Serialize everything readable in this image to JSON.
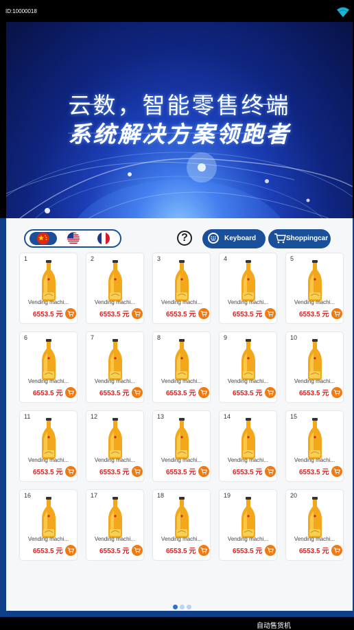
{
  "status_bar": {
    "device_id": "ID:10000018",
    "wifi_icon": "wifi-icon"
  },
  "banner": {
    "line1": "云数，智能零售终端",
    "line2": "系统解决方案领跑者"
  },
  "toolbar": {
    "languages": [
      {
        "name": "chinese-flag-icon"
      },
      {
        "name": "us-flag-icon"
      },
      {
        "name": "french-flag-icon"
      }
    ],
    "help_label": "?",
    "keyboard_label": "Keyboard",
    "shoppingcar_label": "Shoppingcar"
  },
  "products": [
    {
      "num": "1",
      "name": "Vending machi...",
      "price": "6553.5 元"
    },
    {
      "num": "2",
      "name": "Vending machi...",
      "price": "6553.5 元"
    },
    {
      "num": "3",
      "name": "Vending machi...",
      "price": "6553.5 元"
    },
    {
      "num": "4",
      "name": "Vending machi...",
      "price": "6553.5 元"
    },
    {
      "num": "5",
      "name": "Vending machi...",
      "price": "6553.5 元"
    },
    {
      "num": "6",
      "name": "Vending machi...",
      "price": "6553.5 元"
    },
    {
      "num": "7",
      "name": "Vending machi...",
      "price": "6553.5 元"
    },
    {
      "num": "8",
      "name": "Vending machi...",
      "price": "6553.5 元"
    },
    {
      "num": "9",
      "name": "Vending machi...",
      "price": "6553.5 元"
    },
    {
      "num": "10",
      "name": "Vending machi...",
      "price": "6553.5 元"
    },
    {
      "num": "11",
      "name": "Vending machi...",
      "price": "6553.5 元"
    },
    {
      "num": "12",
      "name": "Vending machi...",
      "price": "6553.5 元"
    },
    {
      "num": "13",
      "name": "Vending machi...",
      "price": "6553.5 元"
    },
    {
      "num": "14",
      "name": "Vending machi...",
      "price": "6553.5 元"
    },
    {
      "num": "15",
      "name": "Vending machi...",
      "price": "6553.5 元"
    },
    {
      "num": "16",
      "name": "Vending machi...",
      "price": "6553.5 元"
    },
    {
      "num": "17",
      "name": "Vending machi...",
      "price": "6553.5 元"
    },
    {
      "num": "18",
      "name": "Vending machi...",
      "price": "6553.5 元"
    },
    {
      "num": "19",
      "name": "Vending machi...",
      "price": "6553.5 元"
    },
    {
      "num": "20",
      "name": "Vending machi...",
      "price": "6553.5 元"
    }
  ],
  "pagination": {
    "pages": 3,
    "active_index": 0
  },
  "footer": {
    "text": "自动售货机"
  },
  "colors": {
    "primary_blue": "#1a4f99",
    "frame_blue": "#0e3f88",
    "price_red": "#e02020",
    "cart_orange": "#f07a12",
    "dot_active": "#2f6fd0",
    "dot_inactive": "#b8d4f2"
  }
}
